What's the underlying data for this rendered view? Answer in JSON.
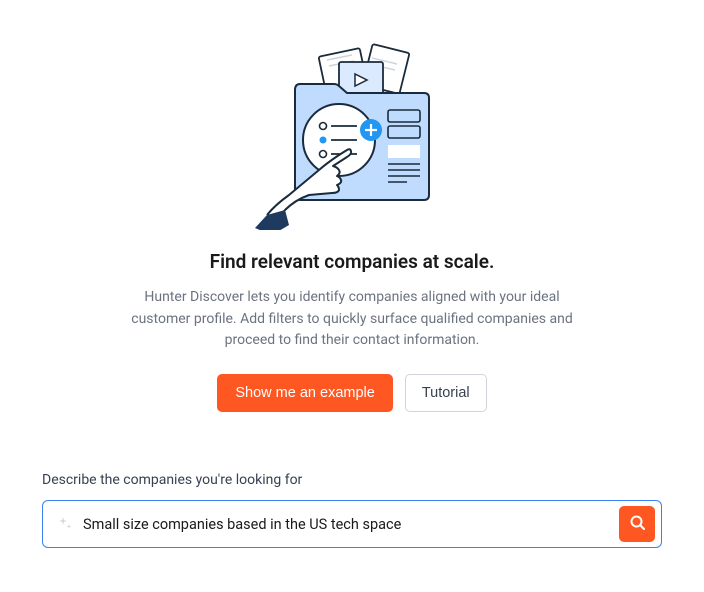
{
  "title": "Find relevant companies at scale.",
  "description": "Hunter Discover lets you identify companies aligned with your ideal customer profile. Add filters to quickly surface qualified companies and proceed to find their contact information.",
  "buttons": {
    "example": "Show me an example",
    "tutorial": "Tutorial"
  },
  "search": {
    "label": "Describe the companies you're looking for",
    "value": "Small size companies based in the US tech space"
  },
  "colors": {
    "accent": "#ff5722",
    "focus": "#3b82f6"
  }
}
